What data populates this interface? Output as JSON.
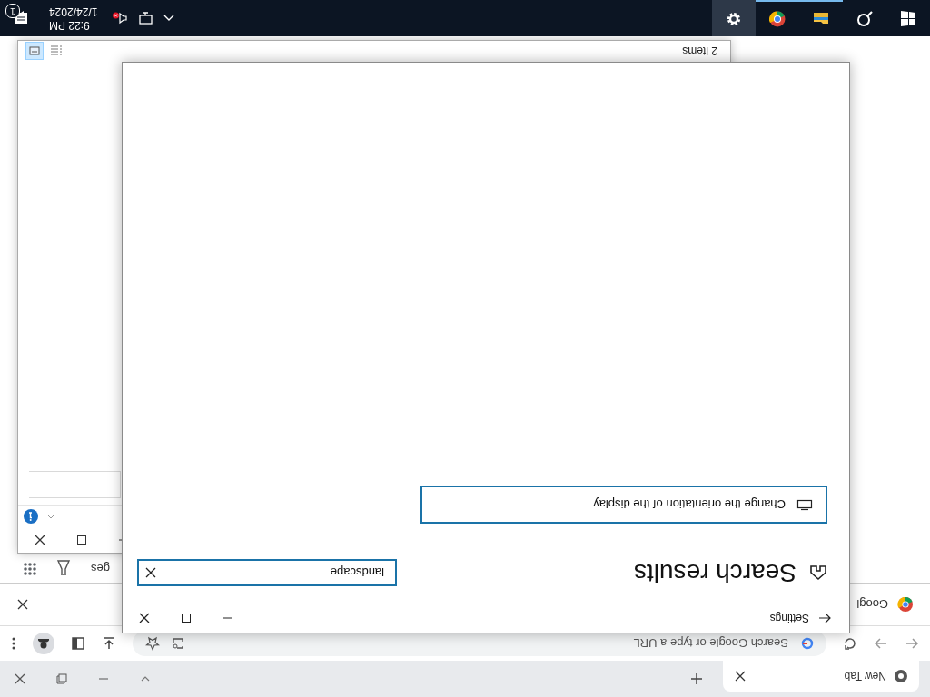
{
  "taskbar": {
    "apps": [
      {
        "kind": "start",
        "open": false,
        "selected": false
      },
      {
        "kind": "search",
        "open": false,
        "selected": false
      },
      {
        "kind": "explorer",
        "open": true,
        "selected": false
      },
      {
        "kind": "chrome",
        "open": true,
        "selected": false
      },
      {
        "kind": "settings",
        "open": true,
        "selected": true
      }
    ],
    "tray": {
      "volume_muted": true,
      "time": "9:22 PM",
      "date": "1/24/2024",
      "notifications": "1"
    }
  },
  "browser": {
    "tabs": [
      {
        "title": "New Tab",
        "selected": true
      }
    ],
    "omnibox": {
      "placeholder": "Search Google or type a URL"
    },
    "infobar": {
      "text": "Googl"
    },
    "page_links": [
      {
        "text": "ges"
      }
    ]
  },
  "explorer": {
    "status": "2 items",
    "views": [
      {
        "kind": "details",
        "selected": false
      },
      {
        "kind": "large_icons",
        "selected": true
      }
    ]
  },
  "settings": {
    "title": "Settings",
    "heading": "Search results",
    "search": {
      "value": "landscape"
    },
    "results": [
      {
        "text": "Change the orientation of the display"
      }
    ]
  }
}
